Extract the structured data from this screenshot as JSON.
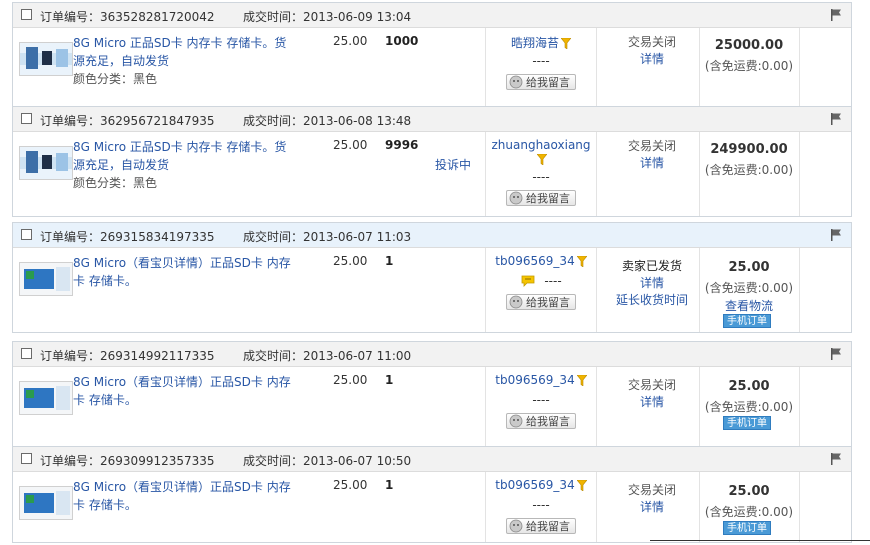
{
  "labels": {
    "order_no": "订单编号：",
    "deal_time": "成交时间：",
    "leave_message": "给我留言",
    "color_label": "颜色分类：",
    "detail": "详情",
    "free_shipping_prefix": "(含免运费:",
    "free_shipping_suffix": ")"
  },
  "orders": [
    {
      "order_no": "363528281720042",
      "time": "2013-06-09 13:04",
      "title": "8G Micro 正品SD卡 内存卡 存储卡。货源充足，自动发货",
      "attr": "颜色分类：黑色",
      "price": "25.00",
      "qty": "1000",
      "complain": "",
      "seller": "晧翔海苔",
      "wangwang": "----",
      "status_main": "交易关闭",
      "status_detail": "详情",
      "status_extra": "",
      "total": "25000.00",
      "shipping": "(含免运费:0.00)",
      "logistics": "",
      "mobile": ""
    },
    {
      "order_no": "362956721847935",
      "time": "2013-06-08 13:48",
      "title": "8G Micro 正品SD卡 内存卡 存储卡。货源充足，自动发货",
      "attr": "颜色分类：黑色",
      "price": "25.00",
      "qty": "9996",
      "complain": "投诉中",
      "seller": "zhuanghaoxiang",
      "wangwang": "----",
      "status_main": "交易关闭",
      "status_detail": "详情",
      "status_extra": "",
      "total": "249900.00",
      "shipping": "(含免运费:0.00)",
      "logistics": "",
      "mobile": ""
    },
    {
      "order_no": "269315834197335",
      "time": "2013-06-07 11:03",
      "title": "8G Micro（看宝贝详情）正品SD卡 内存卡 存储卡。",
      "attr": "",
      "price": "25.00",
      "qty": "1",
      "complain": "",
      "seller": "tb096569_34",
      "wangwang": "----",
      "status_main": "卖家已发货",
      "status_detail": "详情",
      "status_extra": "延长收货时间",
      "total": "25.00",
      "shipping": "(含免运费:0.00)",
      "logistics": "查看物流",
      "mobile": "手机订单"
    },
    {
      "order_no": "269314992117335",
      "time": "2013-06-07 11:00",
      "title": "8G Micro（看宝贝详情）正品SD卡 内存卡 存储卡。",
      "attr": "",
      "price": "25.00",
      "qty": "1",
      "complain": "",
      "seller": "tb096569_34",
      "wangwang": "----",
      "status_main": "交易关闭",
      "status_detail": "详情",
      "status_extra": "",
      "total": "25.00",
      "shipping": "(含免运费:0.00)",
      "logistics": "",
      "mobile": "手机订单"
    },
    {
      "order_no": "269309912357335",
      "time": "2013-06-07 10:50",
      "title": "8G Micro（看宝贝详情）正品SD卡 内存卡 存储卡。",
      "attr": "",
      "price": "25.00",
      "qty": "1",
      "complain": "",
      "seller": "tb096569_34",
      "wangwang": "----",
      "status_main": "交易关闭",
      "status_detail": "详情",
      "status_extra": "",
      "total": "25.00",
      "shipping": "(含免运费:0.00)",
      "logistics": "",
      "mobile": "手机订单"
    }
  ],
  "colors": {
    "link": "#2856a5",
    "header_bg": "#f2f2f2",
    "header_bg_highlight": "#e8f2fb",
    "mobile_badge": "#4a9ad6"
  },
  "icons": [
    "flag-icon",
    "filter-icon",
    "chat-bubble-icon",
    "wangwang-face-icon",
    "product-thumbnail"
  ]
}
